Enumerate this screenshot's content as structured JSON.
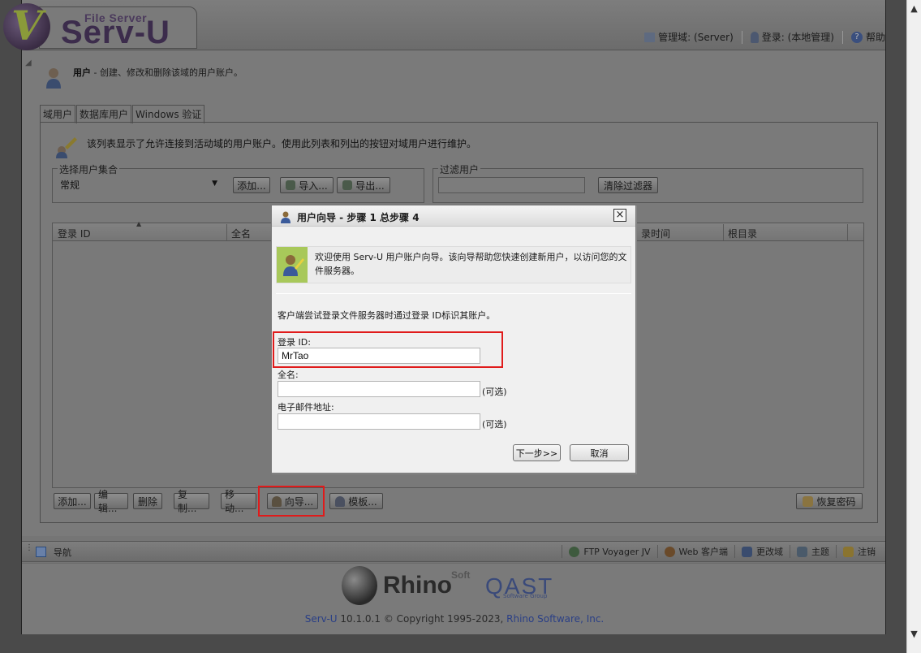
{
  "header": {
    "logo_small": "File Server",
    "logo_big": "Serv-U",
    "domain_link": "管理域: (Server)",
    "login_link": "登录: (本地管理)",
    "help_link": "帮助"
  },
  "page": {
    "title_bold": "用户",
    "title_rest": " - 创建、修改和删除该域的用户账户。",
    "tabs": [
      "域用户",
      "数据库用户",
      "Windows 验证"
    ],
    "description": "该列表显示了允许连接到活动域的用户账户。使用此列表和列出的按钮对域用户进行维护。",
    "set_legend": "选择用户集合",
    "set_value": "常规",
    "add_set": "添加...",
    "import": "导入...",
    "export": "导出...",
    "filter_legend": "过滤用户",
    "clear_filter": "清除过滤器",
    "columns": [
      "登录 ID",
      "全名",
      "录时间",
      "根目录"
    ],
    "bottom_buttons": {
      "add": "添加...",
      "edit": "编辑...",
      "delete": "删除",
      "copy": "复制...",
      "move": "移动...",
      "wizard": "向导...",
      "template": "模板...",
      "recover": "恢复密码"
    }
  },
  "statusbar": {
    "nav": "导航",
    "ftp_voyager": "FTP Voyager JV",
    "web_client": "Web 客户端",
    "change_domain": "更改域",
    "theme": "主题",
    "logout": "注销"
  },
  "footer": {
    "rhino": "Rhino",
    "soft": "Soft",
    "qast": "QAST",
    "qast_sub": "Software Group",
    "servu": "Serv-U",
    "version": " 10.1.0.1 © Copyright 1995-2023, ",
    "company": "Rhino Software, Inc."
  },
  "dialog": {
    "title": "用户向导 - 步骤 1 总步骤 4",
    "banner": "欢迎使用 Serv-U 用户账户向导。该向导帮助您快速创建新用户，以访问您的文件服务器。",
    "info": "客户端尝试登录文件服务器时通过登录 ID标识其账户。",
    "login_label": "登录 ID:",
    "login_value": "MrTao",
    "fullname_label": "全名:",
    "fullname_value": "",
    "email_label": "电子邮件地址:",
    "email_value": "",
    "optional": "(可选)",
    "next": "下一步>>",
    "cancel": "取消"
  }
}
